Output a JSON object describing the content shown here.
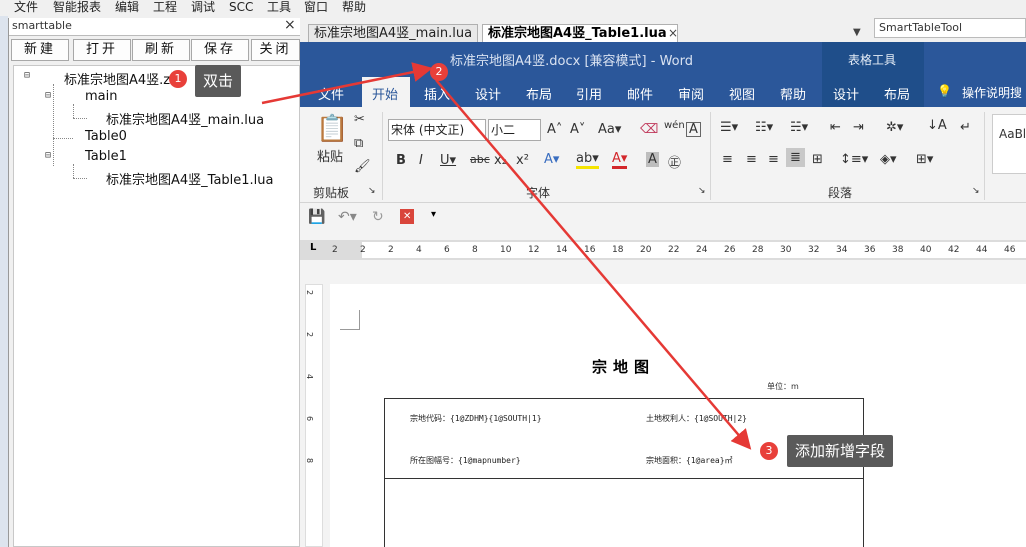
{
  "app_menu": [
    "文件",
    "智能报表",
    "编辑",
    "工程",
    "调试",
    "SCC",
    "工具",
    "窗口",
    "帮助"
  ],
  "left_panel": {
    "title": "smarttable",
    "close_icon": "×",
    "toolbar": [
      "新建",
      "打开",
      "刷新",
      "保存",
      "关闭"
    ],
    "tree": {
      "root": "标准宗地图A4竖.zip",
      "main": "main",
      "main_file": "标准宗地图A4竖_main.lua",
      "table0": "Table0",
      "table1": "Table1",
      "table1_file": "标准宗地图A4竖_Table1.lua"
    }
  },
  "editor_tabs": [
    "标准宗地图A4竖_main.lua",
    "标准宗地图A4竖_Table1.lua"
  ],
  "right_panel_title": "SmartTableTool",
  "word": {
    "title": "标准宗地图A4竖.docx [兼容模式]  -  Word",
    "context_label": "表格工具",
    "tabs": [
      "文件",
      "开始",
      "插入",
      "设计",
      "布局",
      "引用",
      "邮件",
      "审阅",
      "视图",
      "帮助",
      "设计",
      "布局",
      "操作说明搜"
    ],
    "ribbon": {
      "paste": "粘贴",
      "clipboard_group": "剪贴板",
      "font_name": "宋体 (中文正)",
      "font_size": "小二",
      "font_group": "字体",
      "paragraph_group": "段落",
      "style_preview": "AaBl"
    },
    "ruler_numbers": [
      "2",
      "2",
      "2",
      "4",
      "6",
      "8",
      "10",
      "12",
      "14",
      "16",
      "18",
      "20",
      "22",
      "24",
      "26",
      "28",
      "30",
      "32",
      "34",
      "36",
      "38",
      "40",
      "42",
      "44",
      "46"
    ],
    "vruler_numbers": [
      "2",
      "2",
      "4",
      "6",
      "8"
    ],
    "document": {
      "heading": "宗地图",
      "unit": "单位：m",
      "cells": [
        "宗地代码：{1@ZDHM}{1@SOUTH|1}",
        "土地权利人：{1@SOUTH|2}",
        "所在图幅号：{1@mapnumber}",
        "宗地面积：{1@area}㎡"
      ]
    }
  },
  "annotations": [
    {
      "num": "1",
      "text": "双击"
    },
    {
      "num": "2",
      "text": ""
    },
    {
      "num": "3",
      "text": "添加新增字段"
    }
  ],
  "colors": {
    "word_blue": "#2b579a",
    "badge_red": "#e8403a",
    "arrow": "#e53935",
    "callout_bg": "#5a5a5a"
  }
}
